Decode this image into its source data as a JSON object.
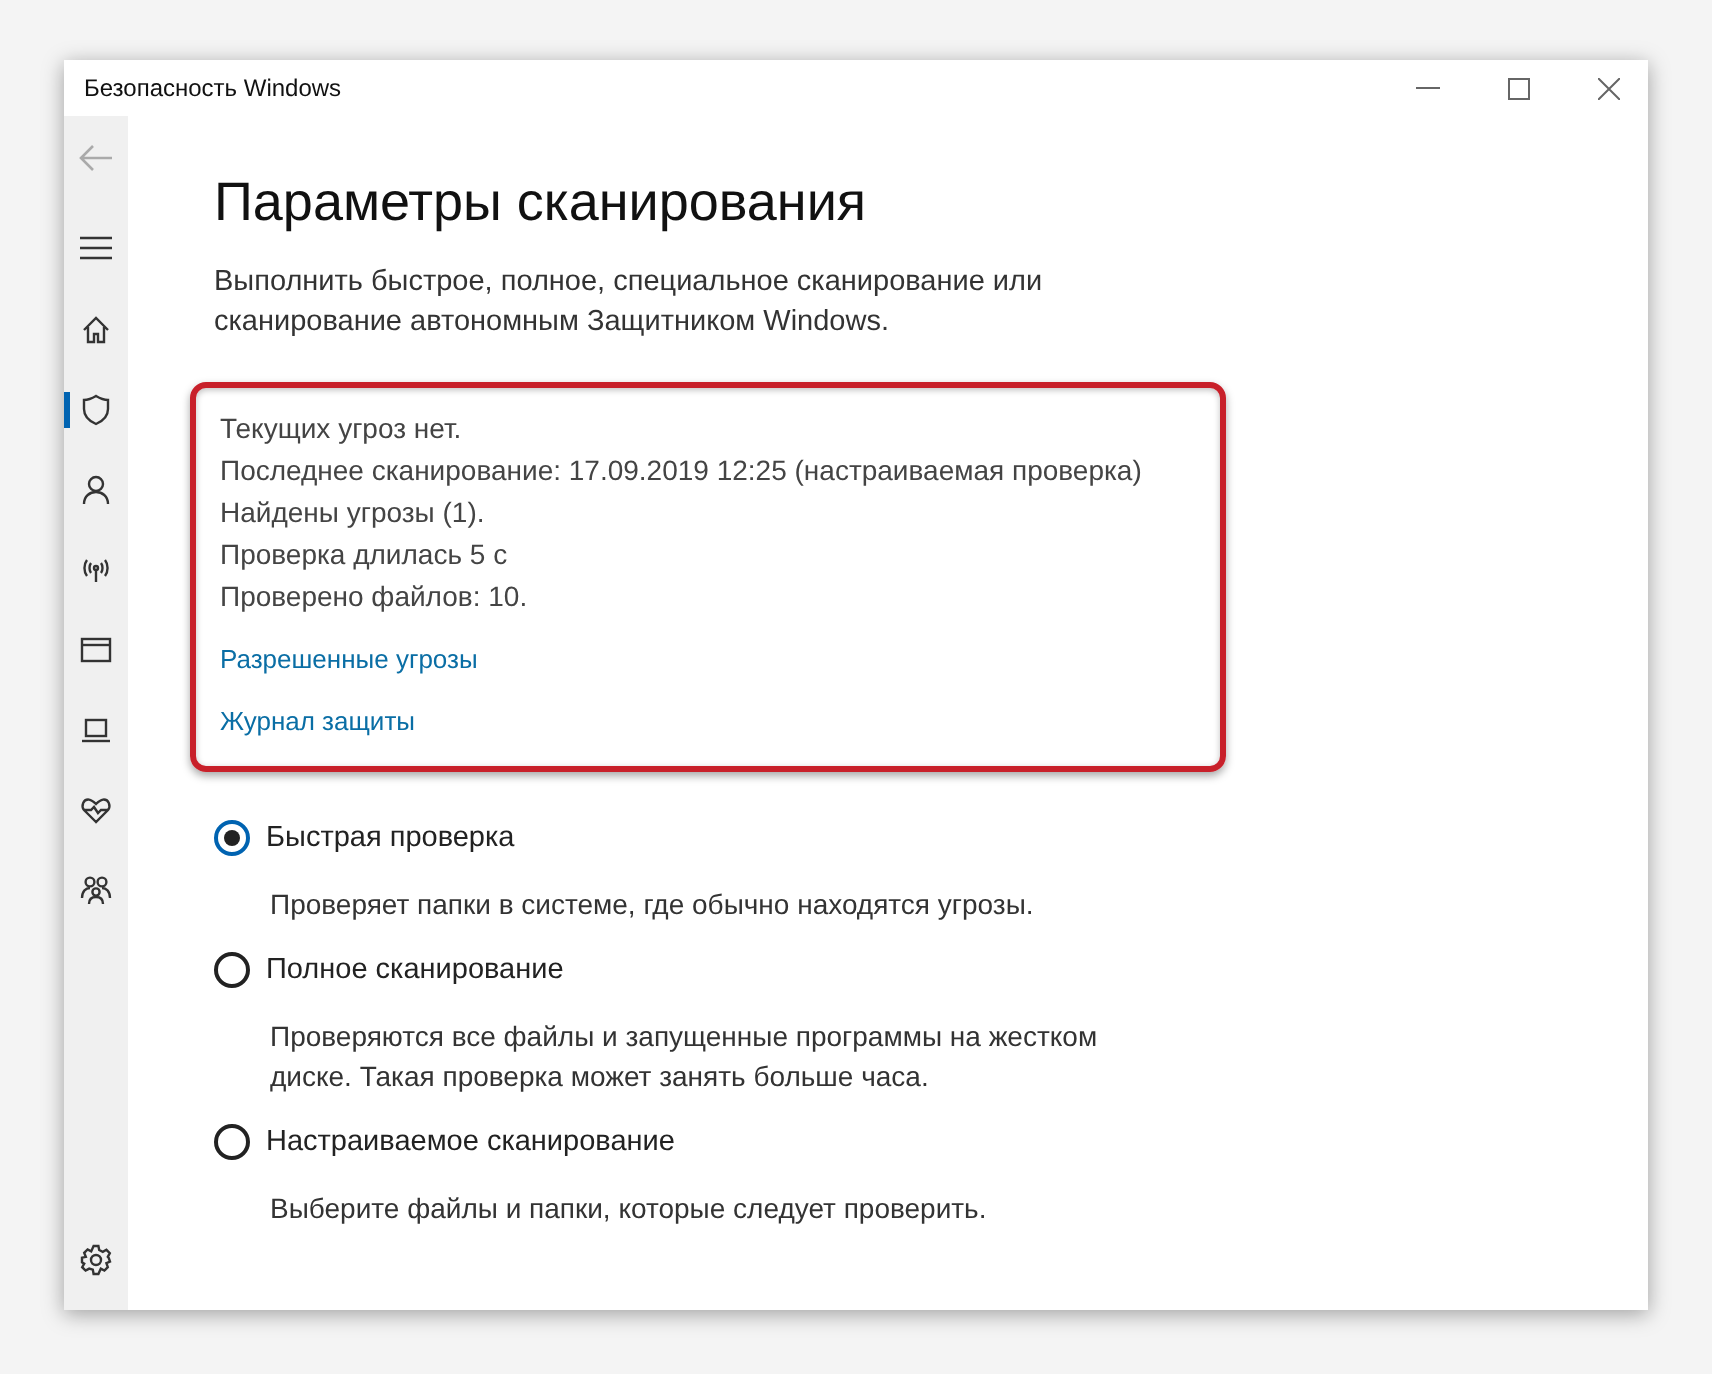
{
  "window": {
    "title": "Безопасность Windows"
  },
  "sidebar": {
    "items": [
      {
        "selected": false
      },
      {
        "selected": true
      },
      {
        "selected": false
      },
      {
        "selected": false
      },
      {
        "selected": false
      },
      {
        "selected": false
      },
      {
        "selected": false
      },
      {
        "selected": false
      }
    ]
  },
  "page": {
    "title": "Параметры сканирования",
    "description": "Выполнить быстрое, полное, специальное сканирование или сканирование автономным Защитником Windows."
  },
  "status": {
    "lines": [
      "Текущих угроз нет.",
      "Последнее сканирование: 17.09.2019 12:25 (настраиваемая проверка)",
      "Найдены угрозы (1).",
      "Проверка длилась 5 с",
      "Проверено файлов: 10."
    ],
    "links": [
      "Разрешенные угрозы",
      "Журнал защиты"
    ]
  },
  "scan_options": [
    {
      "label": "Быстрая проверка",
      "description": "Проверяет папки в системе, где обычно находятся угрозы.",
      "selected": true
    },
    {
      "label": "Полное сканирование",
      "description": "Проверяются все файлы и запущенные программы на жестком диске. Такая проверка может занять больше часа.",
      "selected": false
    },
    {
      "label": "Настраиваемое сканирование",
      "description": "Выберите файлы и папки, которые следует проверить.",
      "selected": false
    }
  ]
}
